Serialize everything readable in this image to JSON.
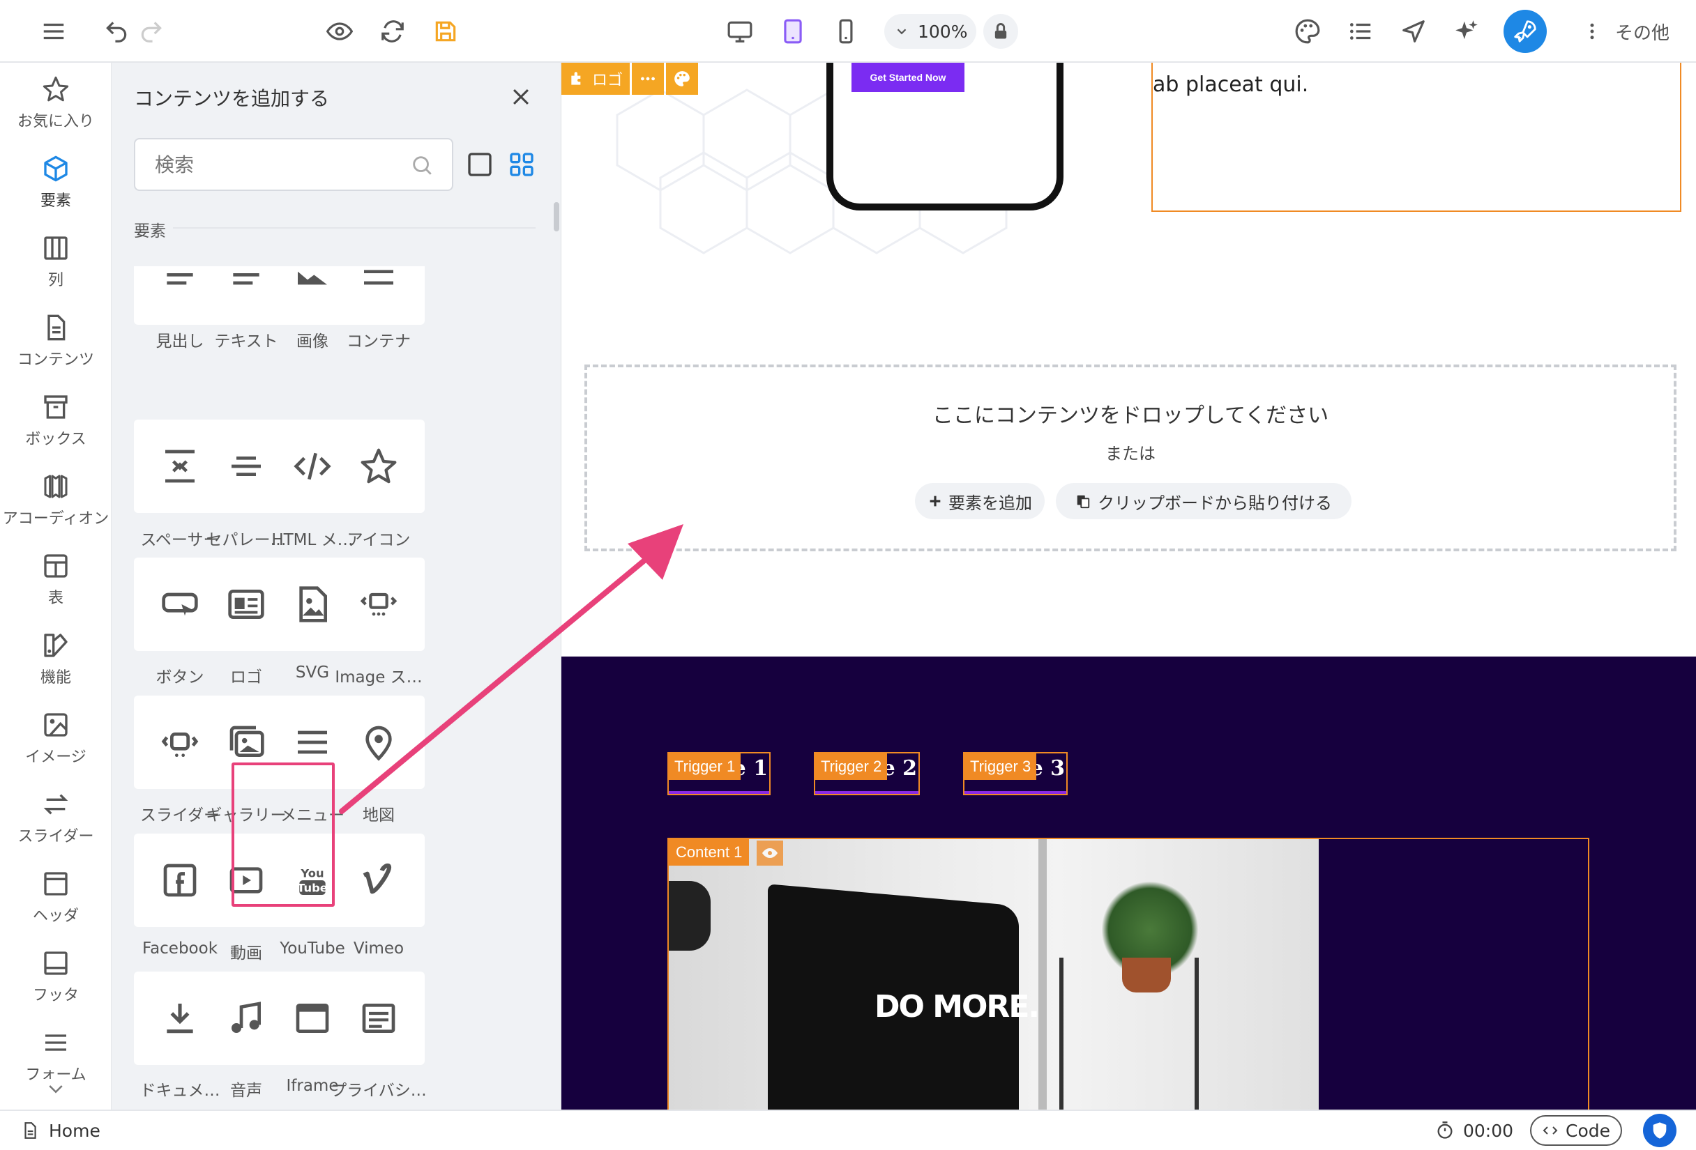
{
  "toolbar": {
    "zoom": "100%",
    "more_label": "その他",
    "accent": "#f5a623",
    "active_device_color": "#8a5cf6"
  },
  "rail": {
    "items": [
      {
        "label": "お気に入り",
        "icon": "star-icon"
      },
      {
        "label": "要素",
        "icon": "cube-icon",
        "active": true
      },
      {
        "label": "列",
        "icon": "columns-icon"
      },
      {
        "label": "コンテンツ",
        "icon": "document-icon"
      },
      {
        "label": "ボックス",
        "icon": "archive-box-icon"
      },
      {
        "label": "アコーディオン",
        "icon": "accordion-icon"
      },
      {
        "label": "表",
        "icon": "table-icon"
      },
      {
        "label": "機能",
        "icon": "features-icon"
      },
      {
        "label": "イメージ",
        "icon": "image-icon"
      },
      {
        "label": "スライダー",
        "icon": "arrows-swap-icon"
      },
      {
        "label": "ヘッダ",
        "icon": "header-icon"
      },
      {
        "label": "フッタ",
        "icon": "footer-icon"
      },
      {
        "label": "フォーム",
        "icon": "form-icon"
      }
    ]
  },
  "panel": {
    "title": "コンテンツを追加する",
    "search_placeholder": "検索",
    "section": "要素",
    "tiles": [
      {
        "label": "見出し",
        "icon": "heading-icon"
      },
      {
        "label": "テキスト",
        "icon": "text-icon"
      },
      {
        "label": "画像",
        "icon": "image-icon"
      },
      {
        "label": "コンテナ",
        "icon": "container-icon"
      },
      {
        "label": "スペーサー",
        "icon": "spacer-icon"
      },
      {
        "label": "セパレー…",
        "icon": "separator-icon"
      },
      {
        "label": "HTML メ…",
        "icon": "code-icon"
      },
      {
        "label": "アイコン",
        "icon": "star-icon"
      },
      {
        "label": "ボタン",
        "icon": "button-icon"
      },
      {
        "label": "ロゴ",
        "icon": "logo-icon"
      },
      {
        "label": "SVG",
        "icon": "svg-icon"
      },
      {
        "label": "Image ス…",
        "icon": "image-slider-icon"
      },
      {
        "label": "スライダー",
        "icon": "slider-icon"
      },
      {
        "label": "ギャラリー",
        "icon": "gallery-icon"
      },
      {
        "label": "メニュー",
        "icon": "menu-icon"
      },
      {
        "label": "地図",
        "icon": "map-pin-icon"
      },
      {
        "label": "Facebook",
        "icon": "facebook-icon"
      },
      {
        "label": "動画",
        "icon": "video-icon"
      },
      {
        "label": "YouTube",
        "icon": "youtube-icon"
      },
      {
        "label": "Vimeo",
        "icon": "vimeo-icon"
      },
      {
        "label": "ドキュメ…",
        "icon": "download-icon"
      },
      {
        "label": "音声",
        "icon": "music-icon"
      },
      {
        "label": "Iframe",
        "icon": "iframe-icon"
      },
      {
        "label": "プライバシ…",
        "icon": "privacy-icon"
      },
      {
        "label": "",
        "icon": "misc-icon"
      }
    ]
  },
  "canvas": {
    "logo_tag": "ロゴ",
    "cta": "Get Started Now",
    "text": "ab placeat qui.",
    "drop_title": "ここにコンテンツをドロップしてください",
    "drop_or": "または",
    "add_element": "要素を追加",
    "paste_clipboard": "クリップボードから貼り付ける",
    "triggers": [
      {
        "tag": "Trigger 1",
        "text": "ne 1"
      },
      {
        "tag": "Trigger 2",
        "text": "ne 2"
      },
      {
        "tag": "Trigger 3",
        "text": "ne 3"
      }
    ],
    "content_tag": "Content 1",
    "photo_text": "DO MORE."
  },
  "bottom": {
    "page": "Home",
    "timer": "00:00",
    "code": "Code"
  }
}
